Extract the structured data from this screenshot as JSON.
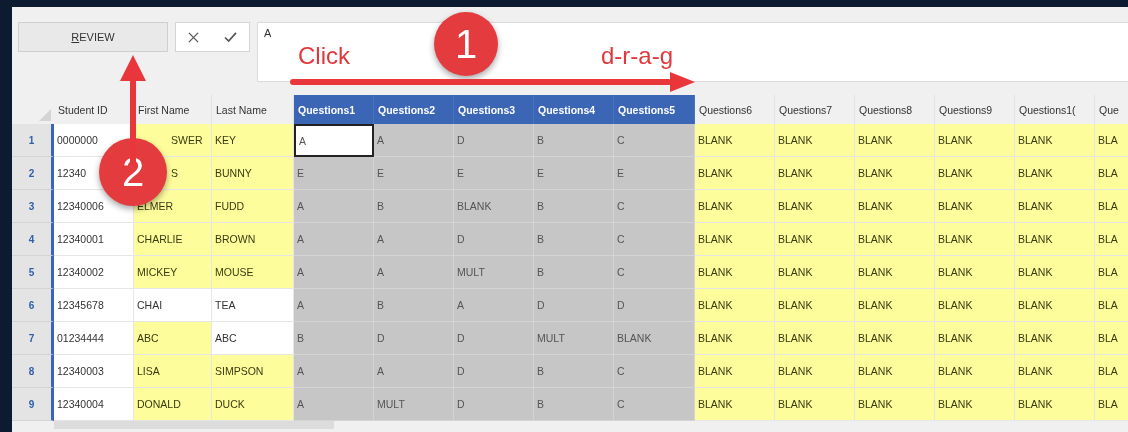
{
  "toolbar": {
    "button": "REVIEW",
    "formula_value": "A"
  },
  "columns": [
    {
      "label": "Student ID",
      "selected": false
    },
    {
      "label": "First Name",
      "selected": false
    },
    {
      "label": "Last Name",
      "selected": false
    },
    {
      "label": "Questions1",
      "selected": true
    },
    {
      "label": "Questions2",
      "selected": true
    },
    {
      "label": "Questions3",
      "selected": true
    },
    {
      "label": "Questions4",
      "selected": true
    },
    {
      "label": "Questions5",
      "selected": true
    },
    {
      "label": "Questions6",
      "selected": false
    },
    {
      "label": "Questions7",
      "selected": false
    },
    {
      "label": "Questions8",
      "selected": false
    },
    {
      "label": "Questions9",
      "selected": false
    },
    {
      "label": "Questions1(",
      "selected": false
    },
    {
      "label": "Que",
      "selected": false
    }
  ],
  "rows": [
    {
      "number": "1",
      "under_callout": true,
      "cells": [
        {
          "text": "0000000",
          "highlighted": false,
          "active": false
        },
        {
          "text": "SWER",
          "highlighted": true,
          "active": false
        },
        {
          "text": "KEY",
          "highlighted": true,
          "active": false
        },
        {
          "text": "A",
          "highlighted": false,
          "active": true
        },
        {
          "text": "A",
          "highlighted": false,
          "active": false
        },
        {
          "text": "D",
          "highlighted": false,
          "active": false
        },
        {
          "text": "B",
          "highlighted": false,
          "active": false
        },
        {
          "text": "C",
          "highlighted": false,
          "active": false
        },
        {
          "text": "BLANK",
          "highlighted": true,
          "active": false
        },
        {
          "text": "BLANK",
          "highlighted": true,
          "active": false
        },
        {
          "text": "BLANK",
          "highlighted": true,
          "active": false
        },
        {
          "text": "BLANK",
          "highlighted": true,
          "active": false
        },
        {
          "text": "BLANK",
          "highlighted": true,
          "active": false
        },
        {
          "text": "BLA",
          "highlighted": true,
          "active": false
        }
      ]
    },
    {
      "number": "2",
      "under_callout": true,
      "cells": [
        {
          "text": "12340",
          "highlighted": false,
          "active": false
        },
        {
          "text": "S",
          "highlighted": true,
          "active": false
        },
        {
          "text": "BUNNY",
          "highlighted": true,
          "active": false
        },
        {
          "text": "E",
          "highlighted": false,
          "active": false
        },
        {
          "text": "E",
          "highlighted": false,
          "active": false
        },
        {
          "text": "E",
          "highlighted": false,
          "active": false
        },
        {
          "text": "E",
          "highlighted": false,
          "active": false
        },
        {
          "text": "E",
          "highlighted": false,
          "active": false
        },
        {
          "text": "BLANK",
          "highlighted": true,
          "active": false
        },
        {
          "text": "BLANK",
          "highlighted": true,
          "active": false
        },
        {
          "text": "BLANK",
          "highlighted": true,
          "active": false
        },
        {
          "text": "BLANK",
          "highlighted": true,
          "active": false
        },
        {
          "text": "BLANK",
          "highlighted": true,
          "active": false
        },
        {
          "text": "BLA",
          "highlighted": true,
          "active": false
        }
      ]
    },
    {
      "number": "3",
      "under_callout": false,
      "cells": [
        {
          "text": "12340006",
          "highlighted": false,
          "active": false
        },
        {
          "text": "ELMER",
          "highlighted": true,
          "active": false
        },
        {
          "text": "FUDD",
          "highlighted": true,
          "active": false
        },
        {
          "text": "A",
          "highlighted": false,
          "active": false
        },
        {
          "text": "B",
          "highlighted": false,
          "active": false
        },
        {
          "text": "BLANK",
          "highlighted": false,
          "active": false
        },
        {
          "text": "B",
          "highlighted": false,
          "active": false
        },
        {
          "text": "C",
          "highlighted": false,
          "active": false
        },
        {
          "text": "BLANK",
          "highlighted": true,
          "active": false
        },
        {
          "text": "BLANK",
          "highlighted": true,
          "active": false
        },
        {
          "text": "BLANK",
          "highlighted": true,
          "active": false
        },
        {
          "text": "BLANK",
          "highlighted": true,
          "active": false
        },
        {
          "text": "BLANK",
          "highlighted": true,
          "active": false
        },
        {
          "text": "BLA",
          "highlighted": true,
          "active": false
        }
      ]
    },
    {
      "number": "4",
      "under_callout": false,
      "cells": [
        {
          "text": "12340001",
          "highlighted": false,
          "active": false
        },
        {
          "text": "CHARLIE",
          "highlighted": true,
          "active": false
        },
        {
          "text": "BROWN",
          "highlighted": true,
          "active": false
        },
        {
          "text": "A",
          "highlighted": false,
          "active": false
        },
        {
          "text": "A",
          "highlighted": false,
          "active": false
        },
        {
          "text": "D",
          "highlighted": false,
          "active": false
        },
        {
          "text": "B",
          "highlighted": false,
          "active": false
        },
        {
          "text": "C",
          "highlighted": false,
          "active": false
        },
        {
          "text": "BLANK",
          "highlighted": true,
          "active": false
        },
        {
          "text": "BLANK",
          "highlighted": true,
          "active": false
        },
        {
          "text": "BLANK",
          "highlighted": true,
          "active": false
        },
        {
          "text": "BLANK",
          "highlighted": true,
          "active": false
        },
        {
          "text": "BLANK",
          "highlighted": true,
          "active": false
        },
        {
          "text": "BLA",
          "highlighted": true,
          "active": false
        }
      ]
    },
    {
      "number": "5",
      "under_callout": false,
      "cells": [
        {
          "text": "12340002",
          "highlighted": false,
          "active": false
        },
        {
          "text": "MICKEY",
          "highlighted": true,
          "active": false
        },
        {
          "text": "MOUSE",
          "highlighted": true,
          "active": false
        },
        {
          "text": "A",
          "highlighted": false,
          "active": false
        },
        {
          "text": "A",
          "highlighted": false,
          "active": false
        },
        {
          "text": "MULT",
          "highlighted": false,
          "active": false
        },
        {
          "text": "B",
          "highlighted": false,
          "active": false
        },
        {
          "text": "C",
          "highlighted": false,
          "active": false
        },
        {
          "text": "BLANK",
          "highlighted": true,
          "active": false
        },
        {
          "text": "BLANK",
          "highlighted": true,
          "active": false
        },
        {
          "text": "BLANK",
          "highlighted": true,
          "active": false
        },
        {
          "text": "BLANK",
          "highlighted": true,
          "active": false
        },
        {
          "text": "BLANK",
          "highlighted": true,
          "active": false
        },
        {
          "text": "BLA",
          "highlighted": true,
          "active": false
        }
      ]
    },
    {
      "number": "6",
      "under_callout": false,
      "cells": [
        {
          "text": "12345678",
          "highlighted": false,
          "active": false
        },
        {
          "text": "CHAI",
          "highlighted": false,
          "active": false
        },
        {
          "text": "TEA",
          "highlighted": false,
          "active": false
        },
        {
          "text": "A",
          "highlighted": false,
          "active": false
        },
        {
          "text": "B",
          "highlighted": false,
          "active": false
        },
        {
          "text": "A",
          "highlighted": false,
          "active": false
        },
        {
          "text": "D",
          "highlighted": false,
          "active": false
        },
        {
          "text": "D",
          "highlighted": false,
          "active": false
        },
        {
          "text": "BLANK",
          "highlighted": true,
          "active": false
        },
        {
          "text": "BLANK",
          "highlighted": true,
          "active": false
        },
        {
          "text": "BLANK",
          "highlighted": true,
          "active": false
        },
        {
          "text": "BLANK",
          "highlighted": true,
          "active": false
        },
        {
          "text": "BLANK",
          "highlighted": true,
          "active": false
        },
        {
          "text": "BLA",
          "highlighted": true,
          "active": false
        }
      ]
    },
    {
      "number": "7",
      "under_callout": false,
      "cells": [
        {
          "text": "01234444",
          "highlighted": false,
          "active": false
        },
        {
          "text": "ABC",
          "highlighted": true,
          "active": false
        },
        {
          "text": "ABC",
          "highlighted": false,
          "active": false
        },
        {
          "text": "B",
          "highlighted": false,
          "active": false
        },
        {
          "text": "D",
          "highlighted": false,
          "active": false
        },
        {
          "text": "D",
          "highlighted": false,
          "active": false
        },
        {
          "text": "MULT",
          "highlighted": false,
          "active": false
        },
        {
          "text": "BLANK",
          "highlighted": false,
          "active": false
        },
        {
          "text": "BLANK",
          "highlighted": true,
          "active": false
        },
        {
          "text": "BLANK",
          "highlighted": true,
          "active": false
        },
        {
          "text": "BLANK",
          "highlighted": true,
          "active": false
        },
        {
          "text": "BLANK",
          "highlighted": true,
          "active": false
        },
        {
          "text": "BLANK",
          "highlighted": true,
          "active": false
        },
        {
          "text": "BLA",
          "highlighted": true,
          "active": false
        }
      ]
    },
    {
      "number": "8",
      "under_callout": false,
      "cells": [
        {
          "text": "12340003",
          "highlighted": false,
          "active": false
        },
        {
          "text": "LISA",
          "highlighted": true,
          "active": false
        },
        {
          "text": "SIMPSON",
          "highlighted": true,
          "active": false
        },
        {
          "text": "A",
          "highlighted": false,
          "active": false
        },
        {
          "text": "A",
          "highlighted": false,
          "active": false
        },
        {
          "text": "D",
          "highlighted": false,
          "active": false
        },
        {
          "text": "B",
          "highlighted": false,
          "active": false
        },
        {
          "text": "C",
          "highlighted": false,
          "active": false
        },
        {
          "text": "BLANK",
          "highlighted": true,
          "active": false
        },
        {
          "text": "BLANK",
          "highlighted": true,
          "active": false
        },
        {
          "text": "BLANK",
          "highlighted": true,
          "active": false
        },
        {
          "text": "BLANK",
          "highlighted": true,
          "active": false
        },
        {
          "text": "BLANK",
          "highlighted": true,
          "active": false
        },
        {
          "text": "BLA",
          "highlighted": true,
          "active": false
        }
      ]
    },
    {
      "number": "9",
      "under_callout": false,
      "cells": [
        {
          "text": "12340004",
          "highlighted": false,
          "active": false
        },
        {
          "text": "DONALD",
          "highlighted": true,
          "active": false
        },
        {
          "text": "DUCK",
          "highlighted": true,
          "active": false
        },
        {
          "text": "A",
          "highlighted": false,
          "active": false
        },
        {
          "text": "MULT",
          "highlighted": false,
          "active": false
        },
        {
          "text": "D",
          "highlighted": false,
          "active": false
        },
        {
          "text": "B",
          "highlighted": false,
          "active": false
        },
        {
          "text": "C",
          "highlighted": false,
          "active": false
        },
        {
          "text": "BLANK",
          "highlighted": true,
          "active": false
        },
        {
          "text": "BLANK",
          "highlighted": true,
          "active": false
        },
        {
          "text": "BLANK",
          "highlighted": true,
          "active": false
        },
        {
          "text": "BLANK",
          "highlighted": true,
          "active": false
        },
        {
          "text": "BLANK",
          "highlighted": true,
          "active": false
        },
        {
          "text": "BLA",
          "highlighted": true,
          "active": false
        }
      ]
    }
  ],
  "callouts": [
    "1",
    "2"
  ],
  "annotation_labels": [
    "Click",
    "d-r-a-g"
  ]
}
